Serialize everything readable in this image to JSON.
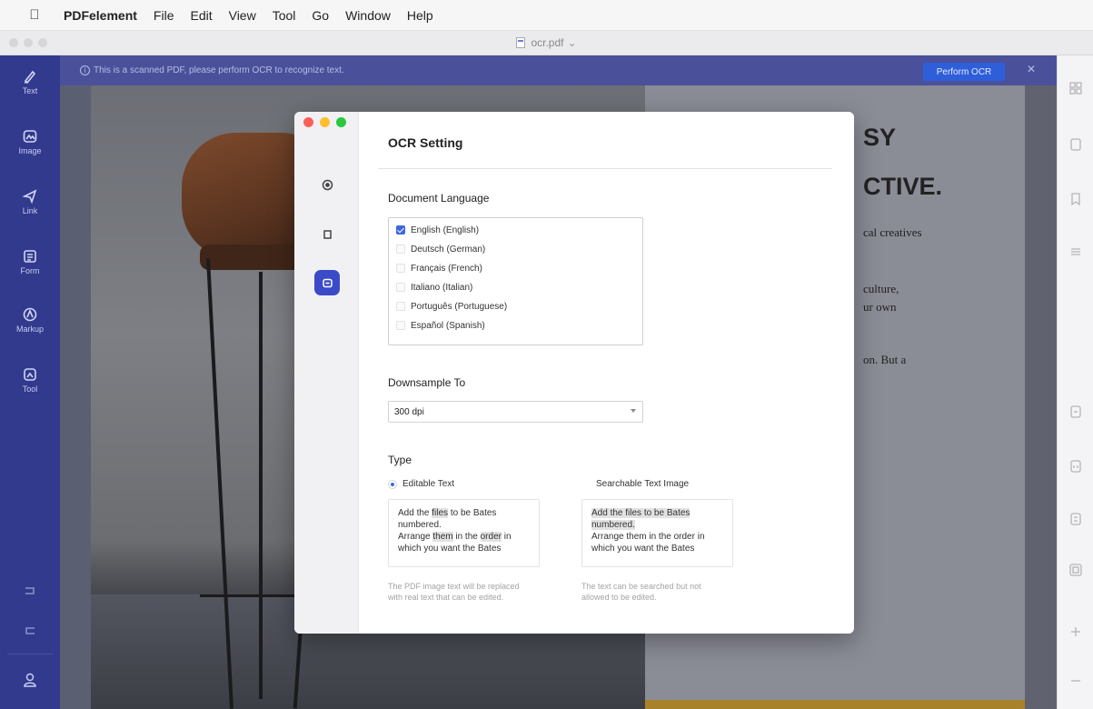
{
  "menubar": {
    "app_name": "PDFelement",
    "menus": [
      "File",
      "Edit",
      "View",
      "Tool",
      "Go",
      "Window",
      "Help"
    ]
  },
  "window": {
    "filename": "ocr.pdf"
  },
  "left_tools": [
    {
      "label": "Text",
      "icon": "pen-icon"
    },
    {
      "label": "Image",
      "icon": "image-icon"
    },
    {
      "label": "Link",
      "icon": "link-icon"
    },
    {
      "label": "Form",
      "icon": "form-icon"
    },
    {
      "label": "Markup",
      "icon": "markup-icon"
    },
    {
      "label": "Tool",
      "icon": "tool-icon"
    }
  ],
  "infobar": {
    "message": "This is a scanned PDF, please perform OCR to recognize text.",
    "button": "Perform OCR"
  },
  "document": {
    "heading1": "SY",
    "heading2": "CTIVE.",
    "line1": "cal creatives",
    "line2": "culture,",
    "line3": "ur own",
    "line4": "on. But a"
  },
  "dialog": {
    "title": "OCR Setting",
    "language_label": "Document Language",
    "languages": [
      {
        "name": "English (English)",
        "checked": true
      },
      {
        "name": "Deutsch (German)",
        "checked": false
      },
      {
        "name": "Français (French)",
        "checked": false
      },
      {
        "name": "Italiano (Italian)",
        "checked": false
      },
      {
        "name": "Português (Portuguese)",
        "checked": false
      },
      {
        "name": "Español (Spanish)",
        "checked": false
      }
    ],
    "downsample_label": "Downsample To",
    "downsample_value": "300 dpi",
    "type_label": "Type",
    "editable": {
      "label": "Editable Text",
      "selected": true,
      "sample": [
        "Add the ",
        "files",
        " to be Bates",
        "numbered.",
        "Arrange ",
        "them",
        " in the ",
        "order",
        " in",
        "which you want the Bates"
      ],
      "hint": "The PDF image text will be replaced with real text that can be edited."
    },
    "searchable": {
      "label": "Searchable Text Image",
      "selected": false,
      "sample": [
        "Add the files to be Bates",
        "numbered.",
        "Arrange them in the order in",
        "which you want the Bates"
      ],
      "hint": "The text can be searched but not allowed to be edited."
    }
  },
  "colors": {
    "sidebar": "#323a8e",
    "accent": "#3c67e3",
    "gold": "#a8822a"
  }
}
